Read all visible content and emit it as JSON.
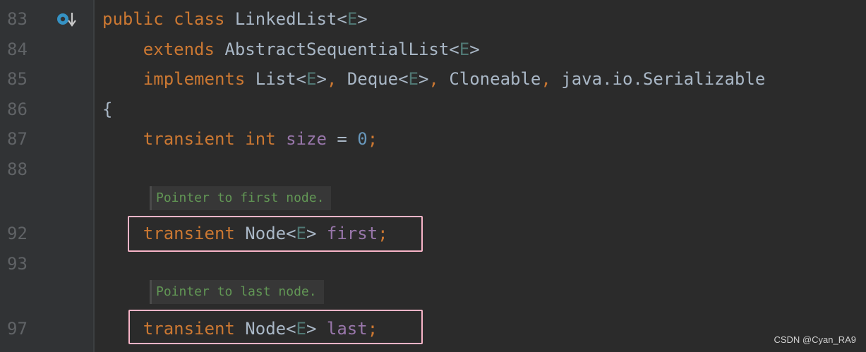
{
  "gutter": {
    "line_numbers": [
      "83",
      "84",
      "85",
      "86",
      "87",
      "88",
      "92",
      "93",
      "97"
    ],
    "icon": "implemented-method-down-arrow-icon"
  },
  "code": {
    "l83": {
      "kw1": "public",
      "kw2": "class",
      "name": "LinkedList",
      "lt": "<",
      "tp": "E",
      "gt": ">"
    },
    "l84": {
      "kw": "extends",
      "name": "AbstractSequentialList",
      "lt": "<",
      "tp": "E",
      "gt": ">"
    },
    "l85": {
      "kw": "implements",
      "t1": "List",
      "t1lt": "<",
      "t1tp": "E",
      "t1gt": ">",
      "c1": ",",
      "t2": "Deque",
      "t2lt": "<",
      "t2tp": "E",
      "t2gt": ">",
      "c2": ",",
      "t3": "Cloneable",
      "c3": ",",
      "t4": "java.io.Serializable"
    },
    "l86": {
      "brace": "{"
    },
    "l87": {
      "kw1": "transient",
      "kw2": "int",
      "field": "size",
      "eq": "=",
      "num": "0",
      "semi": ";"
    },
    "l92": {
      "kw": "transient",
      "type": "Node",
      "lt": "<",
      "tp": "E",
      "gt": ">",
      "field": "first",
      "semi": ";"
    },
    "l97": {
      "kw": "transient",
      "type": "Node",
      "lt": "<",
      "tp": "E",
      "gt": ">",
      "field": "last",
      "semi": ";"
    }
  },
  "docs": {
    "first": "Pointer to first node.",
    "last": "Pointer to last node."
  },
  "colors": {
    "background": "#2b2b2b",
    "gutter": "#313335",
    "keyword": "#cc7832",
    "type_param": "#507874",
    "field": "#9876aa",
    "number": "#6897bb",
    "doc_text": "#629755",
    "highlight_border": "#f8b4c8"
  },
  "watermark": "CSDN @Cyan_RA9"
}
